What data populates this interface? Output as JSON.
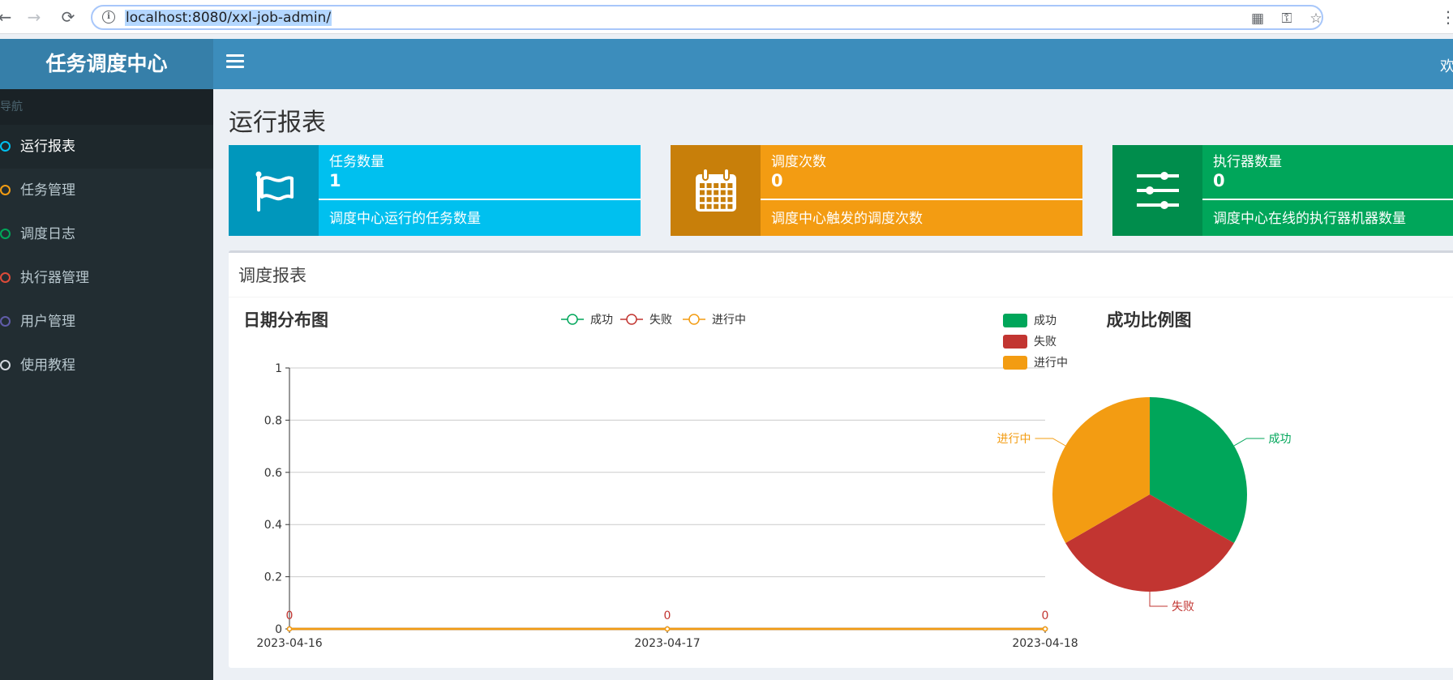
{
  "browser": {
    "url": "localhost:8080/xxl-job-admin/"
  },
  "header": {
    "logo": "任务调度中心",
    "welcome": "欢"
  },
  "sidebar": {
    "section_label": "导航",
    "items": [
      {
        "label": "运行报表",
        "dot_color": "#00c0ef",
        "active": true
      },
      {
        "label": "任务管理",
        "dot_color": "#f39c12",
        "active": false
      },
      {
        "label": "调度日志",
        "dot_color": "#00a65a",
        "active": false
      },
      {
        "label": "执行器管理",
        "dot_color": "#dd4b39",
        "active": false
      },
      {
        "label": "用户管理",
        "dot_color": "#605ca8",
        "active": false
      },
      {
        "label": "使用教程",
        "dot_color": "#d2d6de",
        "active": false
      }
    ]
  },
  "page": {
    "title": "运行报表"
  },
  "info_boxes": [
    {
      "label": "任务数量",
      "number": "1",
      "desc": "调度中心运行的任务数量",
      "color": "#00c0ef",
      "icon_color": "#0097bc",
      "icon": "flag-icon"
    },
    {
      "label": "调度次数",
      "number": "0",
      "desc": "调度中心触发的调度次数",
      "color": "#f39c12",
      "icon_color": "#c87f0a",
      "icon": "calendar-icon"
    },
    {
      "label": "执行器数量",
      "number": "0",
      "desc": "调度中心在线的执行器机器数量",
      "color": "#00a65a",
      "icon_color": "#008d4c",
      "icon": "sliders-icon"
    }
  ],
  "report": {
    "title": "调度报表"
  },
  "colors": {
    "success": "#00a65a",
    "fail": "#c23531",
    "running": "#f39c12"
  },
  "chart_data": [
    {
      "type": "line",
      "title": "日期分布图",
      "x": [
        "2023-04-16",
        "2023-04-17",
        "2023-04-18"
      ],
      "series": [
        {
          "name": "成功",
          "values": [
            0,
            0,
            0
          ]
        },
        {
          "name": "失败",
          "values": [
            0,
            0,
            0
          ]
        },
        {
          "name": "进行中",
          "values": [
            0,
            0,
            0
          ]
        }
      ],
      "ylim": [
        0,
        1
      ],
      "yticks": [
        "0",
        "0.2",
        "0.4",
        "0.6",
        "0.8",
        "1"
      ],
      "legend": "top-center",
      "grid": true
    },
    {
      "type": "pie",
      "title": "成功比例图",
      "labels": [
        "成功",
        "失败",
        "进行中"
      ],
      "values": [
        1,
        1,
        1
      ],
      "legend": "top-left"
    }
  ]
}
